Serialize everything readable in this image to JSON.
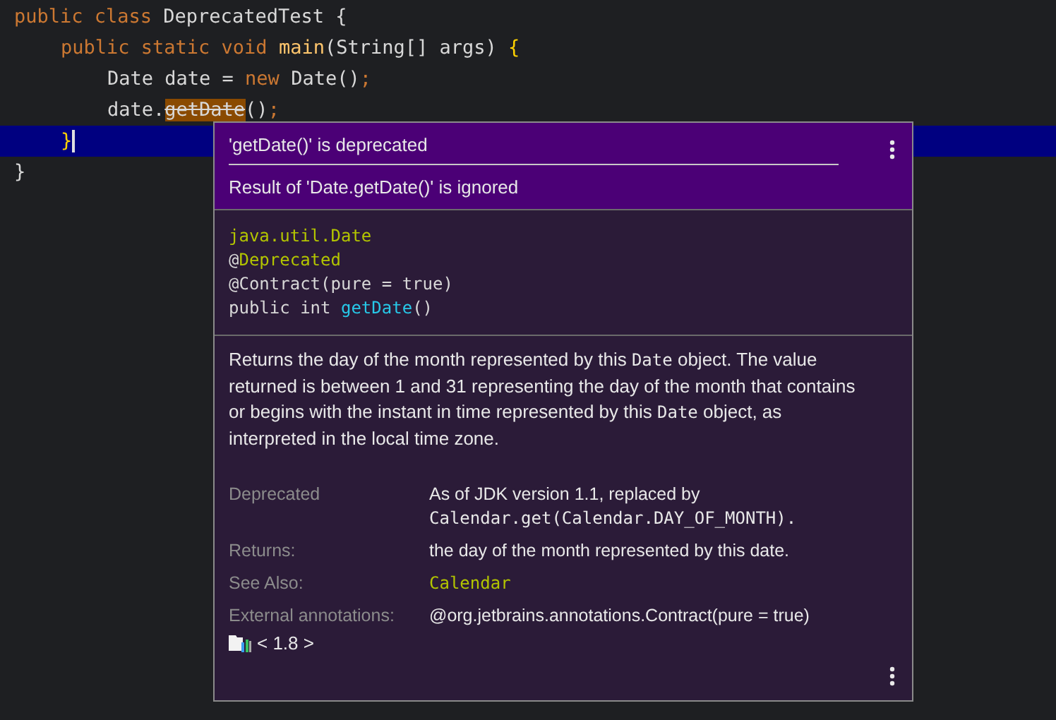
{
  "editor": {
    "lines": [
      {
        "current": false,
        "tokens": [
          {
            "text": "public class ",
            "kind": "keyword"
          },
          {
            "text": "DeprecatedTest {",
            "kind": "plain"
          }
        ],
        "children": [
          {
            "current": false,
            "tokens": [
              {
                "text": "public static void ",
                "kind": "keyword"
              },
              {
                "text": "main",
                "kind": "method"
              },
              {
                "text": "(String[] args) ",
                "kind": "plain"
              },
              {
                "text": "{",
                "kind": "brace"
              }
            ],
            "children": [
              {
                "current": false,
                "tokens": [
                  {
                    "text": "Date date = ",
                    "kind": "plain"
                  },
                  {
                    "text": "new ",
                    "kind": "keyword"
                  },
                  {
                    "text": "Date()",
                    "kind": "plain"
                  },
                  {
                    "text": ";",
                    "kind": "keyword"
                  }
                ]
              },
              {
                "current": false,
                "tokens": [
                  {
                    "text": "date.",
                    "kind": "plain"
                  },
                  {
                    "text": "getDate",
                    "kind": "deprecated"
                  },
                  {
                    "text": "()",
                    "kind": "plain"
                  },
                  {
                    "text": ";",
                    "kind": "keyword"
                  }
                ]
              }
            ]
          },
          {
            "current": true,
            "tokens": [
              {
                "text": "}",
                "kind": "brace"
              }
            ]
          }
        ]
      },
      {
        "current": false,
        "tokens": [
          {
            "text": "}",
            "kind": "plain"
          }
        ]
      }
    ]
  },
  "popup": {
    "problems": [
      "'getDate()' is deprecated",
      "Result of 'Date.getDate()' is ignored"
    ],
    "signature": [
      [
        {
          "text": "java.util.Date",
          "kind": "annotation"
        }
      ],
      [
        {
          "text": "@",
          "kind": "plain"
        },
        {
          "text": "Deprecated",
          "kind": "annotation"
        }
      ],
      [
        {
          "text": "@Contract(pure = true)",
          "kind": "plain"
        }
      ],
      [
        {
          "text": "public int ",
          "kind": "plain"
        },
        {
          "text": "getDate",
          "kind": "method"
        },
        {
          "text": "()",
          "kind": "plain"
        }
      ]
    ],
    "description": [
      {
        "text": "Returns the day of the month represented by this ",
        "mono": false
      },
      {
        "text": "Date",
        "mono": true
      },
      {
        "text": " object. The value returned is between 1 and 31 representing the day of the month that contains or begins with the instant in time represented by this ",
        "mono": false
      },
      {
        "text": "Date",
        "mono": true
      },
      {
        "text": " object, as interpreted in the local time zone.",
        "mono": false
      }
    ],
    "sections": [
      {
        "term": "Deprecated",
        "kind": "text",
        "value": [
          {
            "text": "As of JDK version 1.1, replaced by ",
            "mono": false
          },
          {
            "text": "Calendar.get(Calendar.DAY_OF_MONTH).",
            "mono": true
          }
        ]
      },
      {
        "term": "Returns:",
        "kind": "text",
        "value": [
          {
            "text": "the day of the month represented by this date.",
            "mono": false
          }
        ]
      },
      {
        "term": "See Also:",
        "kind": "link",
        "value": [
          {
            "text": "Calendar",
            "mono": true
          }
        ]
      },
      {
        "term": "External annotations:",
        "kind": "text",
        "value": [
          {
            "text": "@org.jetbrains.annotations.Contract(pure = true)",
            "mono": false
          }
        ]
      }
    ],
    "library": "< 1.8 >"
  }
}
